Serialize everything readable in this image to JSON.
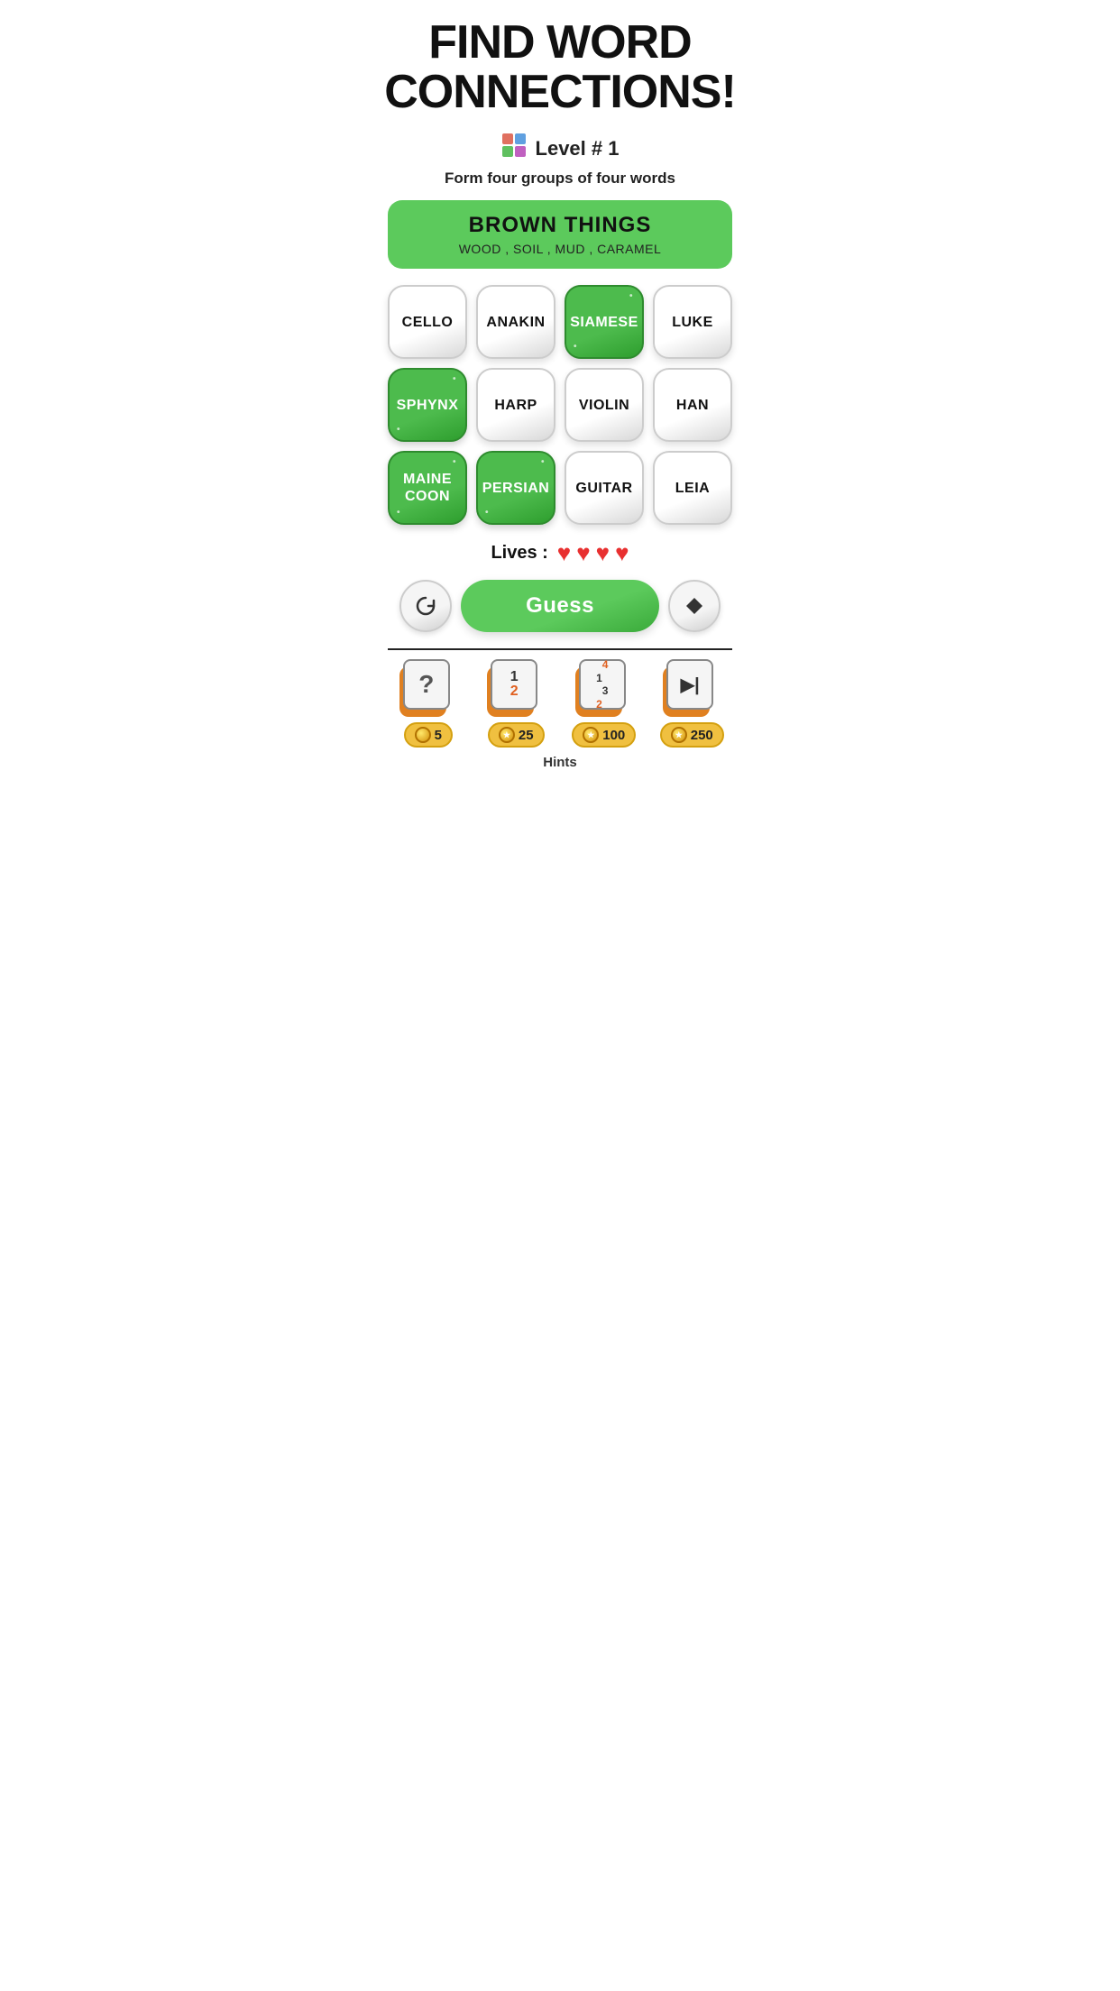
{
  "header": {
    "title_line1": "FIND WORD",
    "title_line2": "CONNECTIONS!"
  },
  "level": {
    "icon": "🟣",
    "label": "Level # 1"
  },
  "instruction": "Form four groups of four words",
  "solved_group": {
    "title": "BROWN THINGS",
    "words": "WOOD , SOIL , MUD , CARAMEL"
  },
  "tiles": [
    {
      "label": "CELLO",
      "selected": false
    },
    {
      "label": "ANAKIN",
      "selected": false
    },
    {
      "label": "SIAMESE",
      "selected": true
    },
    {
      "label": "LUKE",
      "selected": false
    },
    {
      "label": "SPHYNX",
      "selected": true
    },
    {
      "label": "HARP",
      "selected": false
    },
    {
      "label": "VIOLIN",
      "selected": false
    },
    {
      "label": "HAN",
      "selected": false
    },
    {
      "label": "MAINE\nCOON",
      "selected": true
    },
    {
      "label": "PERSIAN",
      "selected": true
    },
    {
      "label": "GUITAR",
      "selected": false
    },
    {
      "label": "LEIA",
      "selected": false
    }
  ],
  "lives": {
    "label": "Lives :",
    "count": 4
  },
  "buttons": {
    "shuffle": "↻",
    "guess": "Guess",
    "erase": "◆"
  },
  "hints": [
    {
      "icon": "?",
      "cost": "5",
      "type": "reveal"
    },
    {
      "icon": "12",
      "cost": "25",
      "type": "swap"
    },
    {
      "icon": "123",
      "cost": "100",
      "type": "arrange"
    },
    {
      "icon": "▶|",
      "cost": "250",
      "type": "skip"
    }
  ],
  "hints_label": "Hints"
}
